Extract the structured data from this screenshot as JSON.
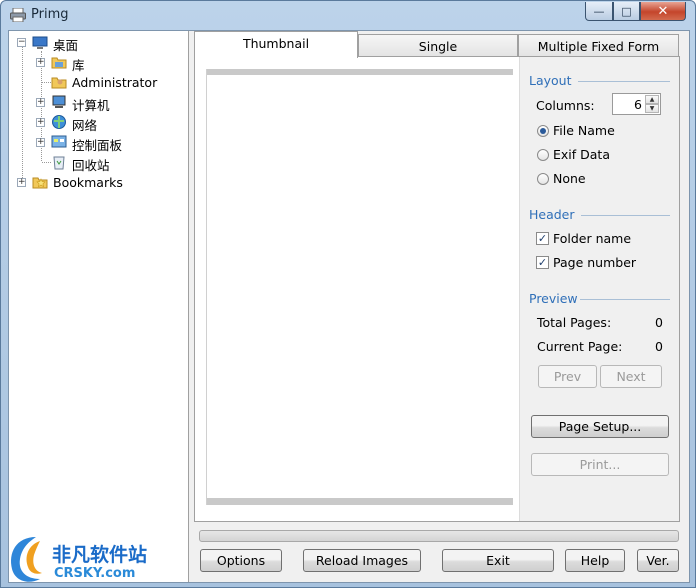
{
  "window": {
    "title": "Primg",
    "min": "—",
    "max": "□",
    "close": "✕"
  },
  "tree": {
    "desktop": "桌面",
    "library": "库",
    "admin": "Administrator",
    "computer": "计算机",
    "network": "网络",
    "control_panel": "控制面板",
    "recycle_bin": "回收站",
    "bookmarks": "Bookmarks",
    "collapse": "−",
    "expand": "+"
  },
  "tabs": {
    "thumbnail": "Thumbnail",
    "single": "Single",
    "fixed": "Multiple Fixed Form"
  },
  "layout": {
    "title": "Layout",
    "columns_label": "Columns:",
    "columns_value": "6",
    "opt_filename": "File Name",
    "opt_exif": "Exif Data",
    "opt_none": "None"
  },
  "header": {
    "title": "Header",
    "folder": "Folder name",
    "page": "Page number"
  },
  "preview": {
    "title": "Preview",
    "total_label": "Total Pages:",
    "total_value": "0",
    "current_label": "Current Page:",
    "current_value": "0",
    "prev": "Prev",
    "next": "Next"
  },
  "buttons": {
    "page_setup": "Page Setup...",
    "print": "Print...",
    "options": "Options",
    "reload": "Reload Images",
    "exit": "Exit",
    "help": "Help",
    "ver": "Ver."
  },
  "watermark": {
    "cn": "非凡软件站",
    "en": "CRSKY.com"
  },
  "colors": {
    "group_header": "#2f6fb8",
    "selected_radio": "#2a5a9a"
  }
}
